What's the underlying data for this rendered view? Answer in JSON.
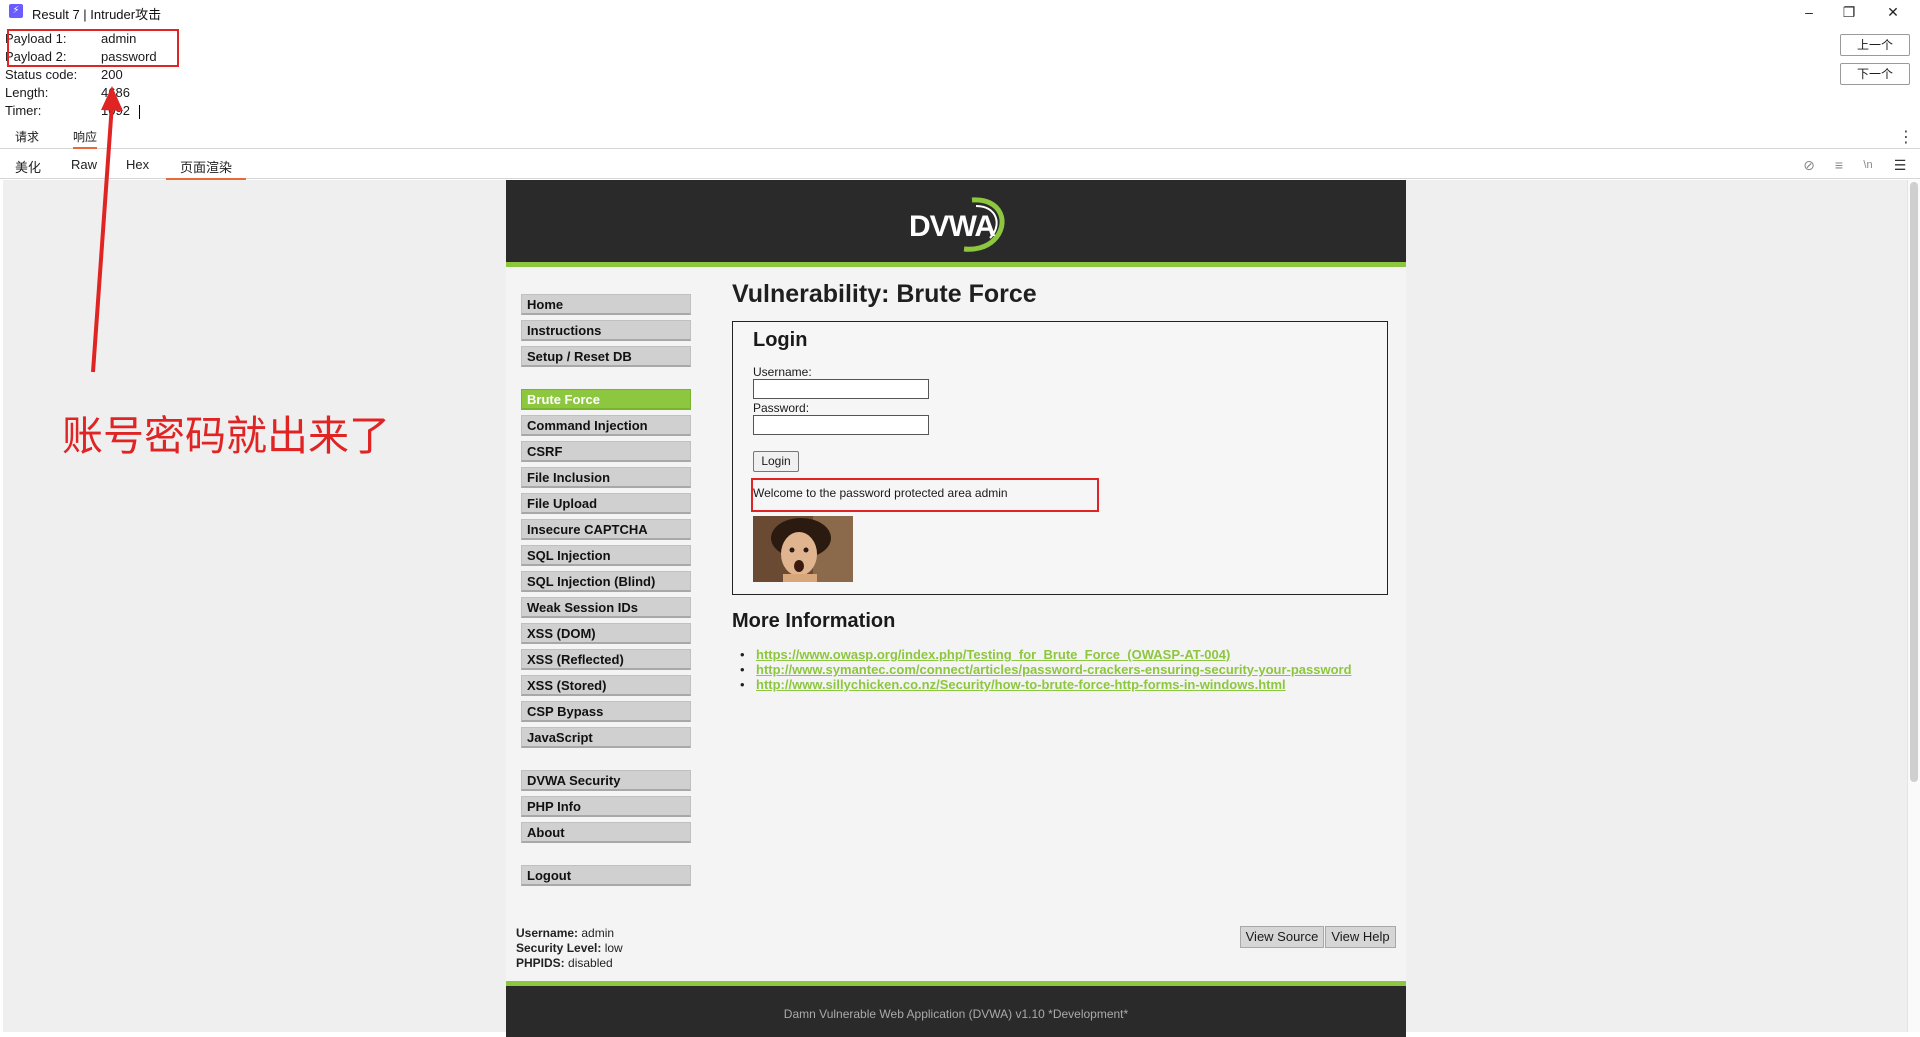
{
  "window": {
    "title": "Result 7 | Intruder攻击",
    "app_icon": "intruder-icon",
    "controls": [
      "minimize-icon",
      "restore-icon",
      "close-icon"
    ]
  },
  "result": {
    "payload1_label": "Payload 1:",
    "payload1_value": "admin",
    "payload2_label": "Payload 2:",
    "payload2_value": "password",
    "status_label": "Status code:",
    "status_value": "200",
    "length_label": "Length:",
    "length_value": "4686",
    "timer_label": "Timer:",
    "timer_value": "1092"
  },
  "nav": {
    "prev": "上一个",
    "next": "下一个"
  },
  "tabs_primary": {
    "request": "请求",
    "response": "响应"
  },
  "tabs_secondary": {
    "pretty": "美化",
    "raw": "Raw",
    "hex": "Hex",
    "render": "页面渲染"
  },
  "toolbar_icons": [
    "hide-icon",
    "wrap-icon",
    "newline-icon",
    "menu-icon"
  ],
  "dvwa": {
    "logo": "DVWA",
    "menu": {
      "group1": [
        "Home",
        "Instructions",
        "Setup / Reset DB"
      ],
      "group2": [
        "Brute Force",
        "Command Injection",
        "CSRF",
        "File Inclusion",
        "File Upload",
        "Insecure CAPTCHA",
        "SQL Injection",
        "SQL Injection (Blind)",
        "Weak Session IDs",
        "XSS (DOM)",
        "XSS (Reflected)",
        "XSS (Stored)",
        "CSP Bypass",
        "JavaScript"
      ],
      "group3": [
        "DVWA Security",
        "PHP Info",
        "About"
      ],
      "group4": [
        "Logout"
      ],
      "active": "Brute Force"
    },
    "page_title": "Vulnerability: Brute Force",
    "login": {
      "title": "Login",
      "username_label": "Username:",
      "password_label": "Password:",
      "button": "Login",
      "welcome": "Welcome to the password protected area admin"
    },
    "more_info_title": "More Information",
    "links": [
      "https://www.owasp.org/index.php/Testing_for_Brute_Force_(OWASP-AT-004)",
      "http://www.symantec.com/connect/articles/password-crackers-ensuring-security-your-password",
      "http://www.sillychicken.co.nz/Security/how-to-brute-force-http-forms-in-windows.html"
    ],
    "userinfo": {
      "username_label": "Username:",
      "username_value": "admin",
      "security_label": "Security Level:",
      "security_value": "low",
      "phpids_label": "PHPIDS:",
      "phpids_value": "disabled"
    },
    "view_source": "View Source",
    "view_help": "View Help",
    "footer": "Damn Vulnerable Web Application (DVWA) v1.10 *Development*"
  },
  "annotation": {
    "text": "账号密码就出来了",
    "color": "#e02424"
  },
  "colors": {
    "dvwa_green": "#8dc63f",
    "dvwa_dark": "#2a2a2a",
    "tab_accent": "#e86a3a"
  }
}
